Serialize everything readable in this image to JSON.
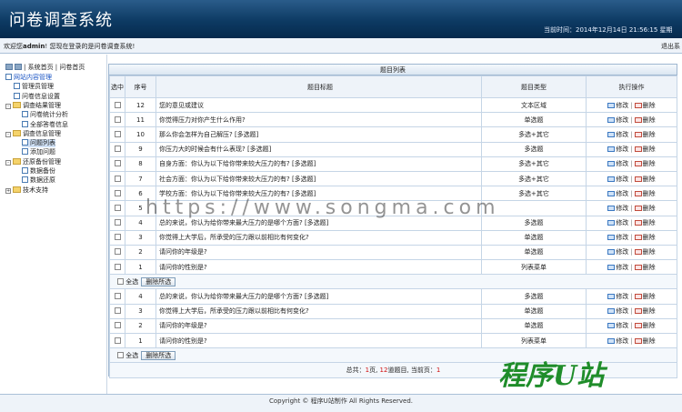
{
  "header": {
    "title": "问卷调查系统",
    "time_label": "当前时间：2014年12月14日  21:56:15 星期"
  },
  "welcome": {
    "prefix": "欢迎您",
    "user": "admin",
    "suffix": "! 您现在登录的是问卷调查系统!",
    "logout": "退出系"
  },
  "sidebar": {
    "top_links": "| 系统首页 | 问卷首页",
    "tree": [
      {
        "label": "网站内容管理",
        "level": 0,
        "kind": "root"
      },
      {
        "label": "管理员管理",
        "level": 1,
        "kind": "doc"
      },
      {
        "label": "问卷信息设置",
        "level": 1,
        "kind": "doc"
      },
      {
        "label": "调查结果管理",
        "level": 0,
        "kind": "folder"
      },
      {
        "label": "问卷统计分析",
        "level": 2,
        "kind": "doc"
      },
      {
        "label": "全部答卷信息",
        "level": 2,
        "kind": "doc"
      },
      {
        "label": "调查信息管理",
        "level": 0,
        "kind": "folder"
      },
      {
        "label": "问题列表",
        "level": 2,
        "kind": "doc",
        "selected": true
      },
      {
        "label": "添加问题",
        "level": 2,
        "kind": "doc"
      },
      {
        "label": "还原备份管理",
        "level": 0,
        "kind": "folder"
      },
      {
        "label": "数据备份",
        "level": 2,
        "kind": "doc"
      },
      {
        "label": "数据还原",
        "level": 2,
        "kind": "doc"
      },
      {
        "label": "技术支持",
        "level": 0,
        "kind": "folder-plus"
      }
    ]
  },
  "table": {
    "caption": "题目列表",
    "headers": {
      "select": "选中",
      "no": "序号",
      "title": "题目标题",
      "type": "题目类型",
      "action": "执行操作"
    },
    "edit_label": "修改",
    "delete_label": "删除",
    "rows_a": [
      {
        "no": "12",
        "title": "您的意见或建议",
        "type": "文本区域"
      },
      {
        "no": "11",
        "title": "你觉得压力对你产生什么作用?",
        "type": "单选题"
      },
      {
        "no": "10",
        "title": "那么你会怎样为自己解压? [多选题]",
        "type": "多选+其它"
      },
      {
        "no": "9",
        "title": "你压力大的时候会有什么表现? [多选题]",
        "type": "多选题"
      },
      {
        "no": "8",
        "title": "自身方面：你认为以下给你带来较大压力的有? [多选题]",
        "type": "多选+其它"
      },
      {
        "no": "7",
        "title": "社会方面：你认为以下给你带来较大压力的有? [多选题]",
        "type": "多选+其它"
      },
      {
        "no": "6",
        "title": "学校方面：你认为以下给你带来较大压力的有? [多选题]",
        "type": "多选+其它"
      },
      {
        "no": "5",
        "title": "",
        "type": ""
      },
      {
        "no": "4",
        "title": "总的来说，你认为给你带来最大压力的是哪个方面? [多选题]",
        "type": "多选题"
      },
      {
        "no": "3",
        "title": "你觉得上大学后，所承受的压力跟以前相比有何变化?",
        "type": "单选题"
      },
      {
        "no": "2",
        "title": "请问你的年级是?",
        "type": "单选题"
      },
      {
        "no": "1",
        "title": "请问你的性别是?",
        "type": "列表菜单"
      }
    ],
    "rows_b": [
      {
        "no": "4",
        "title": "总的来说，你认为给你带来最大压力的是哪个方面? [多选题]",
        "type": "多选题"
      },
      {
        "no": "3",
        "title": "你觉得上大学后，所承受的压力跟以前相比有何变化?",
        "type": "单选题"
      },
      {
        "no": "2",
        "title": "请问你的年级是?",
        "type": "单选题"
      },
      {
        "no": "1",
        "title": "请问你的性别是?",
        "type": "列表菜单"
      }
    ],
    "select_all": "全选",
    "delete_selected": "删除所选",
    "summary_prefix": "总共：",
    "summary_pages": "1",
    "summary_mid1": "页, ",
    "summary_count": "12",
    "summary_mid2": "道题目, 当前页：",
    "summary_current": "1"
  },
  "watermark": "https://www.songma.com",
  "brand_text": "程序U站",
  "copyright": "Copyright © 程序U站制作  All Rights Reserved."
}
